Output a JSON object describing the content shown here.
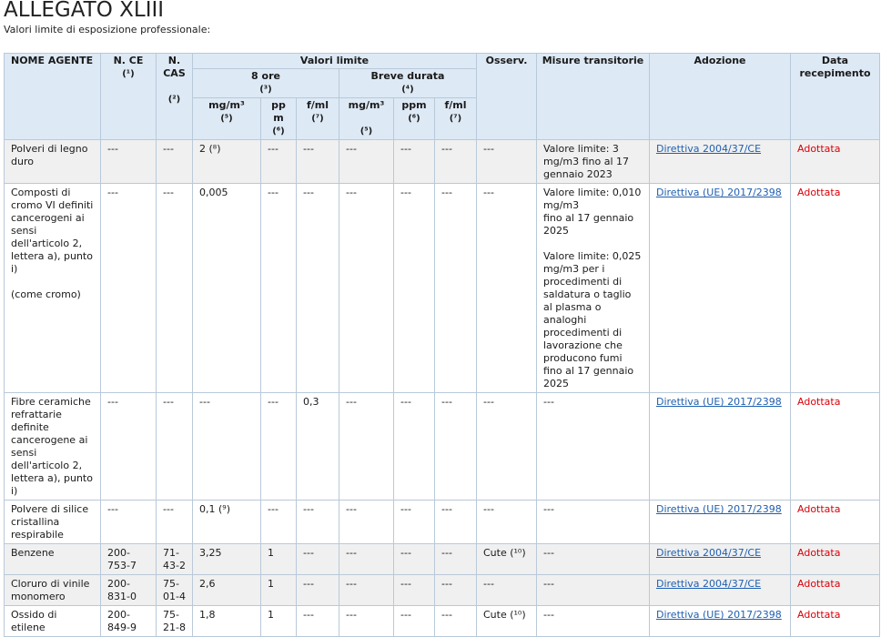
{
  "title": "ALLEGATO XLIII",
  "subtitle": "Valori limite di esposizione professionale:",
  "headers": {
    "nome_agente": "NOME AGENTE",
    "n_ce": "N. CE",
    "n_ce_note": "(¹)",
    "n_cas": "N. CAS",
    "n_cas_note": "(²)",
    "valori_limite": "Valori limite",
    "otto_ore": "8 ore",
    "otto_ore_note": "(³)",
    "breve_durata": "Breve durata",
    "breve_durata_note": "(⁴)",
    "mg_m3_8": "mg/m³",
    "mg_m3_8_note": "(⁵)",
    "ppm_8": "pp m",
    "ppm_8_note": "(⁶)",
    "fml_8": "f/ml",
    "fml_8_note": "(⁷)",
    "mg_m3_bd": "mg/m³",
    "mg_m3_bd_note": "(⁵)",
    "ppm_bd": "ppm",
    "ppm_bd_note": "(⁶)",
    "fml_bd": "f/ml",
    "fml_bd_note": "(⁷)",
    "osserv": "Osserv.",
    "misure": "Misure transitorie",
    "adozione": "Adozione",
    "data_recepimento": "Data recepimento"
  },
  "rows": [
    {
      "nome": "Polveri di legno duro",
      "n_ce": "---",
      "n_cas": "---",
      "mg8": "2 (⁸)",
      "ppm8": "---",
      "fml8": "---",
      "mgbd": "---",
      "ppmbd": "---",
      "fmlbd": "---",
      "osserv": "---",
      "misure": "Valore limite: 3 mg/m3 fino al 17 gennaio 2023",
      "adozione": "Direttiva 2004/37/CE",
      "data": "Adottata"
    },
    {
      "nome": "Composti di cromo VI definiti cancerogeni ai sensi dell'articolo 2, lettera a), punto i)\n\n(come cromo)",
      "n_ce": "---",
      "n_cas": "---",
      "mg8": "0,005",
      "ppm8": "---",
      "fml8": "---",
      "mgbd": "---",
      "ppmbd": "---",
      "fmlbd": "---",
      "osserv": "---",
      "misure": "Valore limite: 0,010 mg/m3\nfino al 17 gennaio 2025\n\nValore limite: 0,025 mg/m3 per i procedimenti di saldatura o taglio al plasma o analoghi procedimenti di lavorazione che producono fumi fino al 17 gennaio 2025",
      "adozione": "Direttiva (UE) 2017/2398",
      "data": "Adottata"
    },
    {
      "nome": "Fibre ceramiche refrattarie definite cancerogene ai sensi dell'articolo 2, lettera a), punto i)",
      "n_ce": "---",
      "n_cas": "---",
      "mg8": "---",
      "ppm8": "---",
      "fml8": "0,3",
      "mgbd": "---",
      "ppmbd": "---",
      "fmlbd": "---",
      "osserv": "---",
      "misure": "---",
      "adozione": "Direttiva (UE) 2017/2398",
      "data": "Adottata"
    },
    {
      "nome": "Polvere di silice cristallina respirabile",
      "n_ce": "---",
      "n_cas": "---",
      "mg8": "0,1 (⁹)",
      "ppm8": "---",
      "fml8": "---",
      "mgbd": "---",
      "ppmbd": "---",
      "fmlbd": "---",
      "osserv": "---",
      "misure": " ---",
      "adozione": "Direttiva (UE) 2017/2398",
      "data": "Adottata"
    },
    {
      "nome": "Benzene",
      "n_ce": "200-753-7",
      "n_cas": "71-43-2",
      "mg8": "3,25",
      "ppm8": "1",
      "fml8": "---",
      "mgbd": "---",
      "ppmbd": "---",
      "fmlbd": "---",
      "osserv": "Cute (¹⁰)",
      "misure": " ---",
      "adozione": "Direttiva 2004/37/CE",
      "data": "Adottata"
    },
    {
      "nome": "Cloruro di vinile monomero",
      "n_ce": "200-831-0",
      "n_cas": "75-01-4",
      "mg8": "2,6",
      "ppm8": "1",
      "fml8": "---",
      "mgbd": "---",
      "ppmbd": "---",
      "fmlbd": "---",
      "osserv": "---",
      "misure": " ---",
      "adozione": "Direttiva 2004/37/CE",
      "data": "Adottata"
    },
    {
      "nome": "Ossido di etilene",
      "n_ce": "200-849-9",
      "n_cas": "75-21-8",
      "mg8": "1,8",
      "ppm8": "1",
      "fml8": "---",
      "mgbd": "---",
      "ppmbd": "---",
      "fmlbd": "---",
      "osserv": "Cute (¹⁰)",
      "misure": "---",
      "adozione": "Direttiva (UE) 2017/2398",
      "data": "Adottata"
    }
  ]
}
